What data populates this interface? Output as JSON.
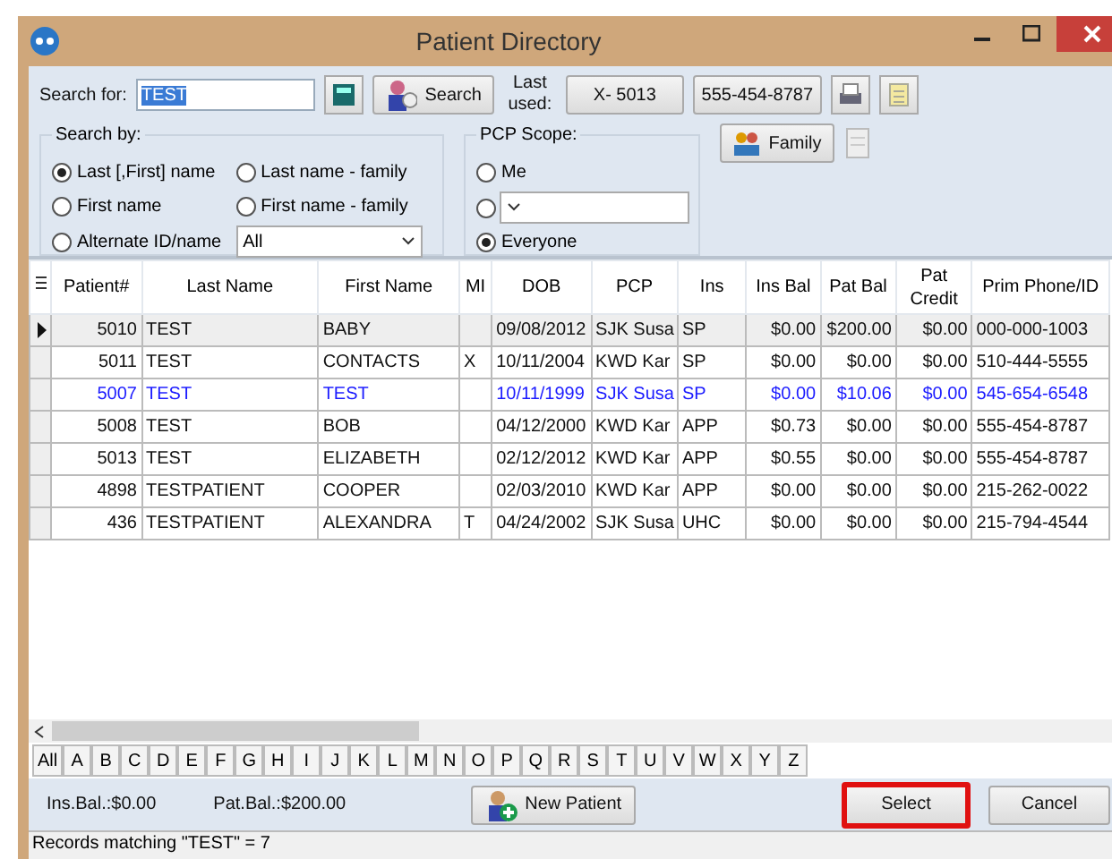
{
  "window": {
    "title": "Patient Directory"
  },
  "search": {
    "label": "Search for:",
    "value": "TEST",
    "button": "Search"
  },
  "last_used": {
    "label": "Last used:",
    "buttons": [
      "X- 5013",
      "555-454-8787"
    ]
  },
  "search_by": {
    "title": "Search by:",
    "options": [
      {
        "label": "Last [,First] name",
        "selected": true
      },
      {
        "label": "Last name - family",
        "selected": false
      },
      {
        "label": "First name",
        "selected": false
      },
      {
        "label": "First name - family",
        "selected": false
      },
      {
        "label": "Alternate ID/name",
        "selected": false
      }
    ],
    "dropdown": "All"
  },
  "pcp_scope": {
    "title": "PCP Scope:",
    "options": [
      {
        "kind": "label",
        "label": "Me",
        "selected": false
      },
      {
        "kind": "dropdown",
        "selected": false
      },
      {
        "kind": "label",
        "label": "Everyone",
        "selected": true
      }
    ]
  },
  "family_button": "Family",
  "table": {
    "columns": [
      "Patient#",
      "Last Name",
      "First Name",
      "MI",
      "DOB",
      "PCP",
      "Ins",
      "Ins Bal",
      "Pat Bal",
      "Pat Credit",
      "Prim Phone/ID"
    ],
    "rows": [
      {
        "current": true,
        "highlighted": false,
        "cells": [
          "5010",
          "TEST",
          "BABY",
          "",
          "09/08/2012",
          "SJK Susa",
          "SP",
          "$0.00",
          "$200.00",
          "$0.00",
          "000-000-1003"
        ]
      },
      {
        "current": false,
        "highlighted": false,
        "cells": [
          "5011",
          "TEST",
          "CONTACTS",
          "X",
          "10/11/2004",
          "KWD Kar",
          "SP",
          "$0.00",
          "$0.00",
          "$0.00",
          "510-444-5555"
        ]
      },
      {
        "current": false,
        "highlighted": true,
        "cells": [
          "5007",
          "TEST",
          "TEST",
          "",
          "10/11/1999",
          "SJK Susa",
          "SP",
          "$0.00",
          "$10.06",
          "$0.00",
          "545-654-6548"
        ]
      },
      {
        "current": false,
        "highlighted": false,
        "cells": [
          "5008",
          "TEST",
          "BOB",
          "",
          "04/12/2000",
          "KWD Kar",
          "APP",
          "$0.73",
          "$0.00",
          "$0.00",
          "555-454-8787"
        ]
      },
      {
        "current": false,
        "highlighted": false,
        "cells": [
          "5013",
          "TEST",
          "ELIZABETH",
          "",
          "02/12/2012",
          "KWD Kar",
          "APP",
          "$0.55",
          "$0.00",
          "$0.00",
          "555-454-8787"
        ]
      },
      {
        "current": false,
        "highlighted": false,
        "cells": [
          "4898",
          "TESTPATIENT",
          "COOPER",
          "",
          "02/03/2010",
          "KWD Kar",
          "APP",
          "$0.00",
          "$0.00",
          "$0.00",
          "215-262-0022"
        ]
      },
      {
        "current": false,
        "highlighted": false,
        "cells": [
          "436",
          "TESTPATIENT",
          "ALEXANDRA",
          "T",
          "04/24/2002",
          "SJK Susa",
          "UHC",
          "$0.00",
          "$0.00",
          "$0.00",
          "215-794-4544"
        ]
      }
    ]
  },
  "letters": [
    "All",
    "A",
    "B",
    "C",
    "D",
    "E",
    "F",
    "G",
    "H",
    "I",
    "J",
    "K",
    "L",
    "M",
    "N",
    "O",
    "P",
    "Q",
    "R",
    "S",
    "T",
    "U",
    "V",
    "W",
    "X",
    "Y",
    "Z"
  ],
  "footer": {
    "ins_bal": "Ins.Bal.:$0.00",
    "pat_bal": "Pat.Bal.:$200.00",
    "new_patient": "New Patient",
    "buttons": [
      {
        "label": "Select",
        "focused": true
      },
      {
        "label": "Cancel",
        "focused": false
      }
    ]
  },
  "status_bar": "Records matching \"TEST\" = 7"
}
